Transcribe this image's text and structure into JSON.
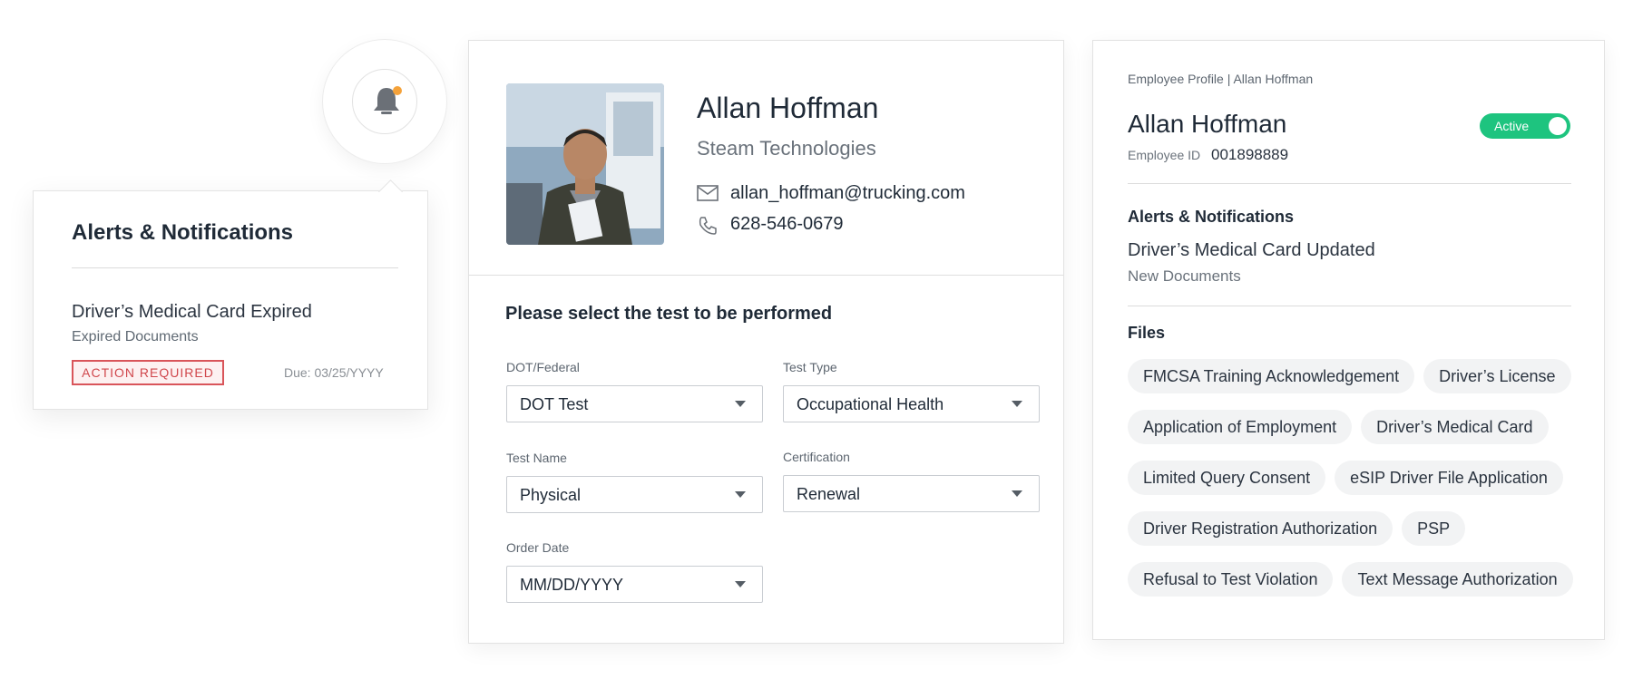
{
  "alerts_panel": {
    "title": "Alerts & Notifications",
    "item": {
      "title": "Driver’s Medical Card Expired",
      "subtitle": "Expired Documents",
      "badge": "ACTION REQUIRED",
      "due": "Due: 03/25/YYYY"
    }
  },
  "contact": {
    "name": "Allan Hoffman",
    "company": "Steam Technologies",
    "email": "allan_hoffman@trucking.com",
    "phone": "628-546-0679"
  },
  "test_form": {
    "heading": "Please select the test to be performed",
    "fields": {
      "dot_federal": {
        "label": "DOT/Federal",
        "value": "DOT Test"
      },
      "test_type": {
        "label": "Test Type",
        "value": "Occupational Health"
      },
      "test_name": {
        "label": "Test Name",
        "value": "Physical"
      },
      "certification": {
        "label": "Certification",
        "value": "Renewal"
      },
      "order_date": {
        "label": "Order Date",
        "value": "MM/DD/YYYY"
      }
    }
  },
  "profile": {
    "breadcrumb": "Employee Profile | Allan Hoffman",
    "name": "Allan Hoffman",
    "status": "Active",
    "employee_id_label": "Employee ID",
    "employee_id": "001898889",
    "alerts_heading": "Alerts & Notifications",
    "alert_title": "Driver’s Medical Card Updated",
    "alert_subtitle": "New Documents",
    "files_heading": "Files",
    "files": [
      [
        "FMCSA Training Acknowledgement",
        "Driver’s License"
      ],
      [
        "Application of Employment",
        "Driver’s Medical Card"
      ],
      [
        "Limited Query Consent",
        "eSIP Driver File Application"
      ],
      [
        "Driver Registration Authorization",
        "PSP"
      ],
      [
        "Refusal to Test Violation",
        "Text Message Authorization"
      ]
    ]
  },
  "colors": {
    "accent_green": "#1ec47f",
    "alert_red": "#d0474c",
    "notification_dot": "#f5a23a",
    "text_dark": "#1f2a37"
  },
  "icons": [
    "bell-icon",
    "email-icon",
    "phone-icon",
    "chevron-down-icon"
  ]
}
